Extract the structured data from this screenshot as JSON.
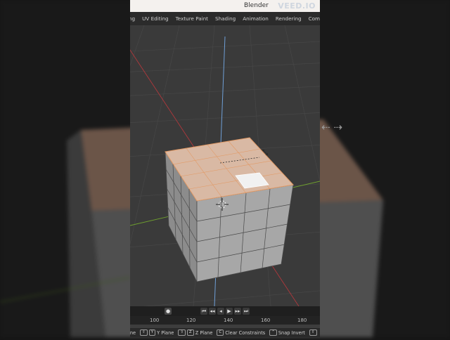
{
  "window": {
    "title": "Blender",
    "watermark": "VEED.IO"
  },
  "workspace_tabs": [
    "ing",
    "UV Editing",
    "Texture Paint",
    "Shading",
    "Animation",
    "Rendering",
    "Compos"
  ],
  "timeline": {
    "buttons": [
      "⏮",
      "◂◂",
      "◂",
      "▶",
      "▸▸",
      "⏭"
    ],
    "ruler_labels": [
      "100",
      "120",
      "140",
      "160",
      "180"
    ]
  },
  "statusbar": [
    {
      "keys": [],
      "label": "lane"
    },
    {
      "keys": [
        "⇧",
        "Y"
      ],
      "label": "Y Plane"
    },
    {
      "keys": [
        "⇧",
        "Z"
      ],
      "label": "Z Plane"
    },
    {
      "keys": [
        "C"
      ],
      "label": "Clear Constraints"
    },
    {
      "keys": [
        "⌃"
      ],
      "label": "Snap Invert"
    },
    {
      "keys": [
        "⇧"
      ],
      "label": ""
    }
  ],
  "colors": {
    "viewport_bg": "#3a3a3a",
    "cube_face": "#a7a7a7",
    "selected_face": "#d9b9a4",
    "x_axis": "#b0383c",
    "y_axis": "#6fa02e",
    "z_axis": "#6f9fd6",
    "edge": "#4a4a4a"
  }
}
